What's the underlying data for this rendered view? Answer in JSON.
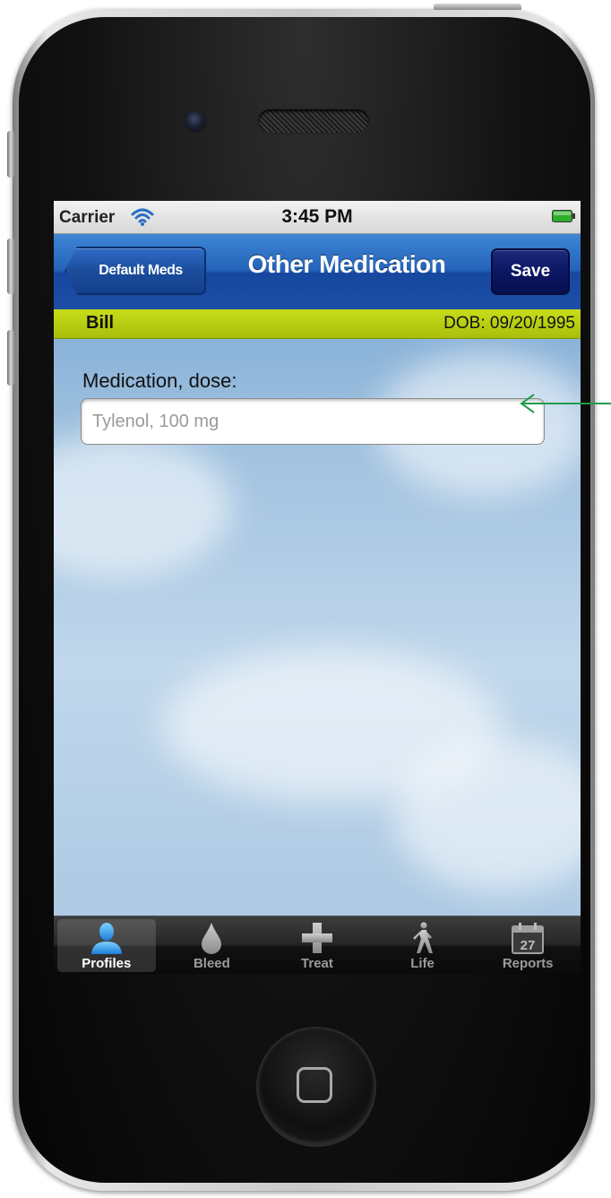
{
  "status_bar": {
    "carrier": "Carrier",
    "time": "3:45 PM",
    "wifi_icon": "wifi-icon",
    "battery_icon": "battery-icon"
  },
  "nav_bar": {
    "back_label": "Default Meds",
    "title": "Other Medication",
    "save_label": "Save",
    "color": "#2463b9"
  },
  "profile_bar": {
    "name": "Bill",
    "dob": "DOB: 09/20/1995",
    "color": "#b4cc12"
  },
  "form": {
    "medication_label": "Medication, dose:",
    "medication_value": "",
    "medication_placeholder": "Tylenol, 100 mg"
  },
  "tab_bar": {
    "tabs": [
      {
        "label": "Profiles",
        "icon": "person-icon",
        "selected": true
      },
      {
        "label": "Bleed",
        "icon": "drop-icon",
        "selected": false
      },
      {
        "label": "Treat",
        "icon": "cross-icon",
        "selected": false
      },
      {
        "label": "Life",
        "icon": "walking-person-icon",
        "selected": false
      },
      {
        "label": "Reports",
        "icon": "calendar-icon",
        "selected": false
      }
    ],
    "calendar_day": "27"
  },
  "annotation": {
    "arrow_color": "#1f9d4b"
  }
}
